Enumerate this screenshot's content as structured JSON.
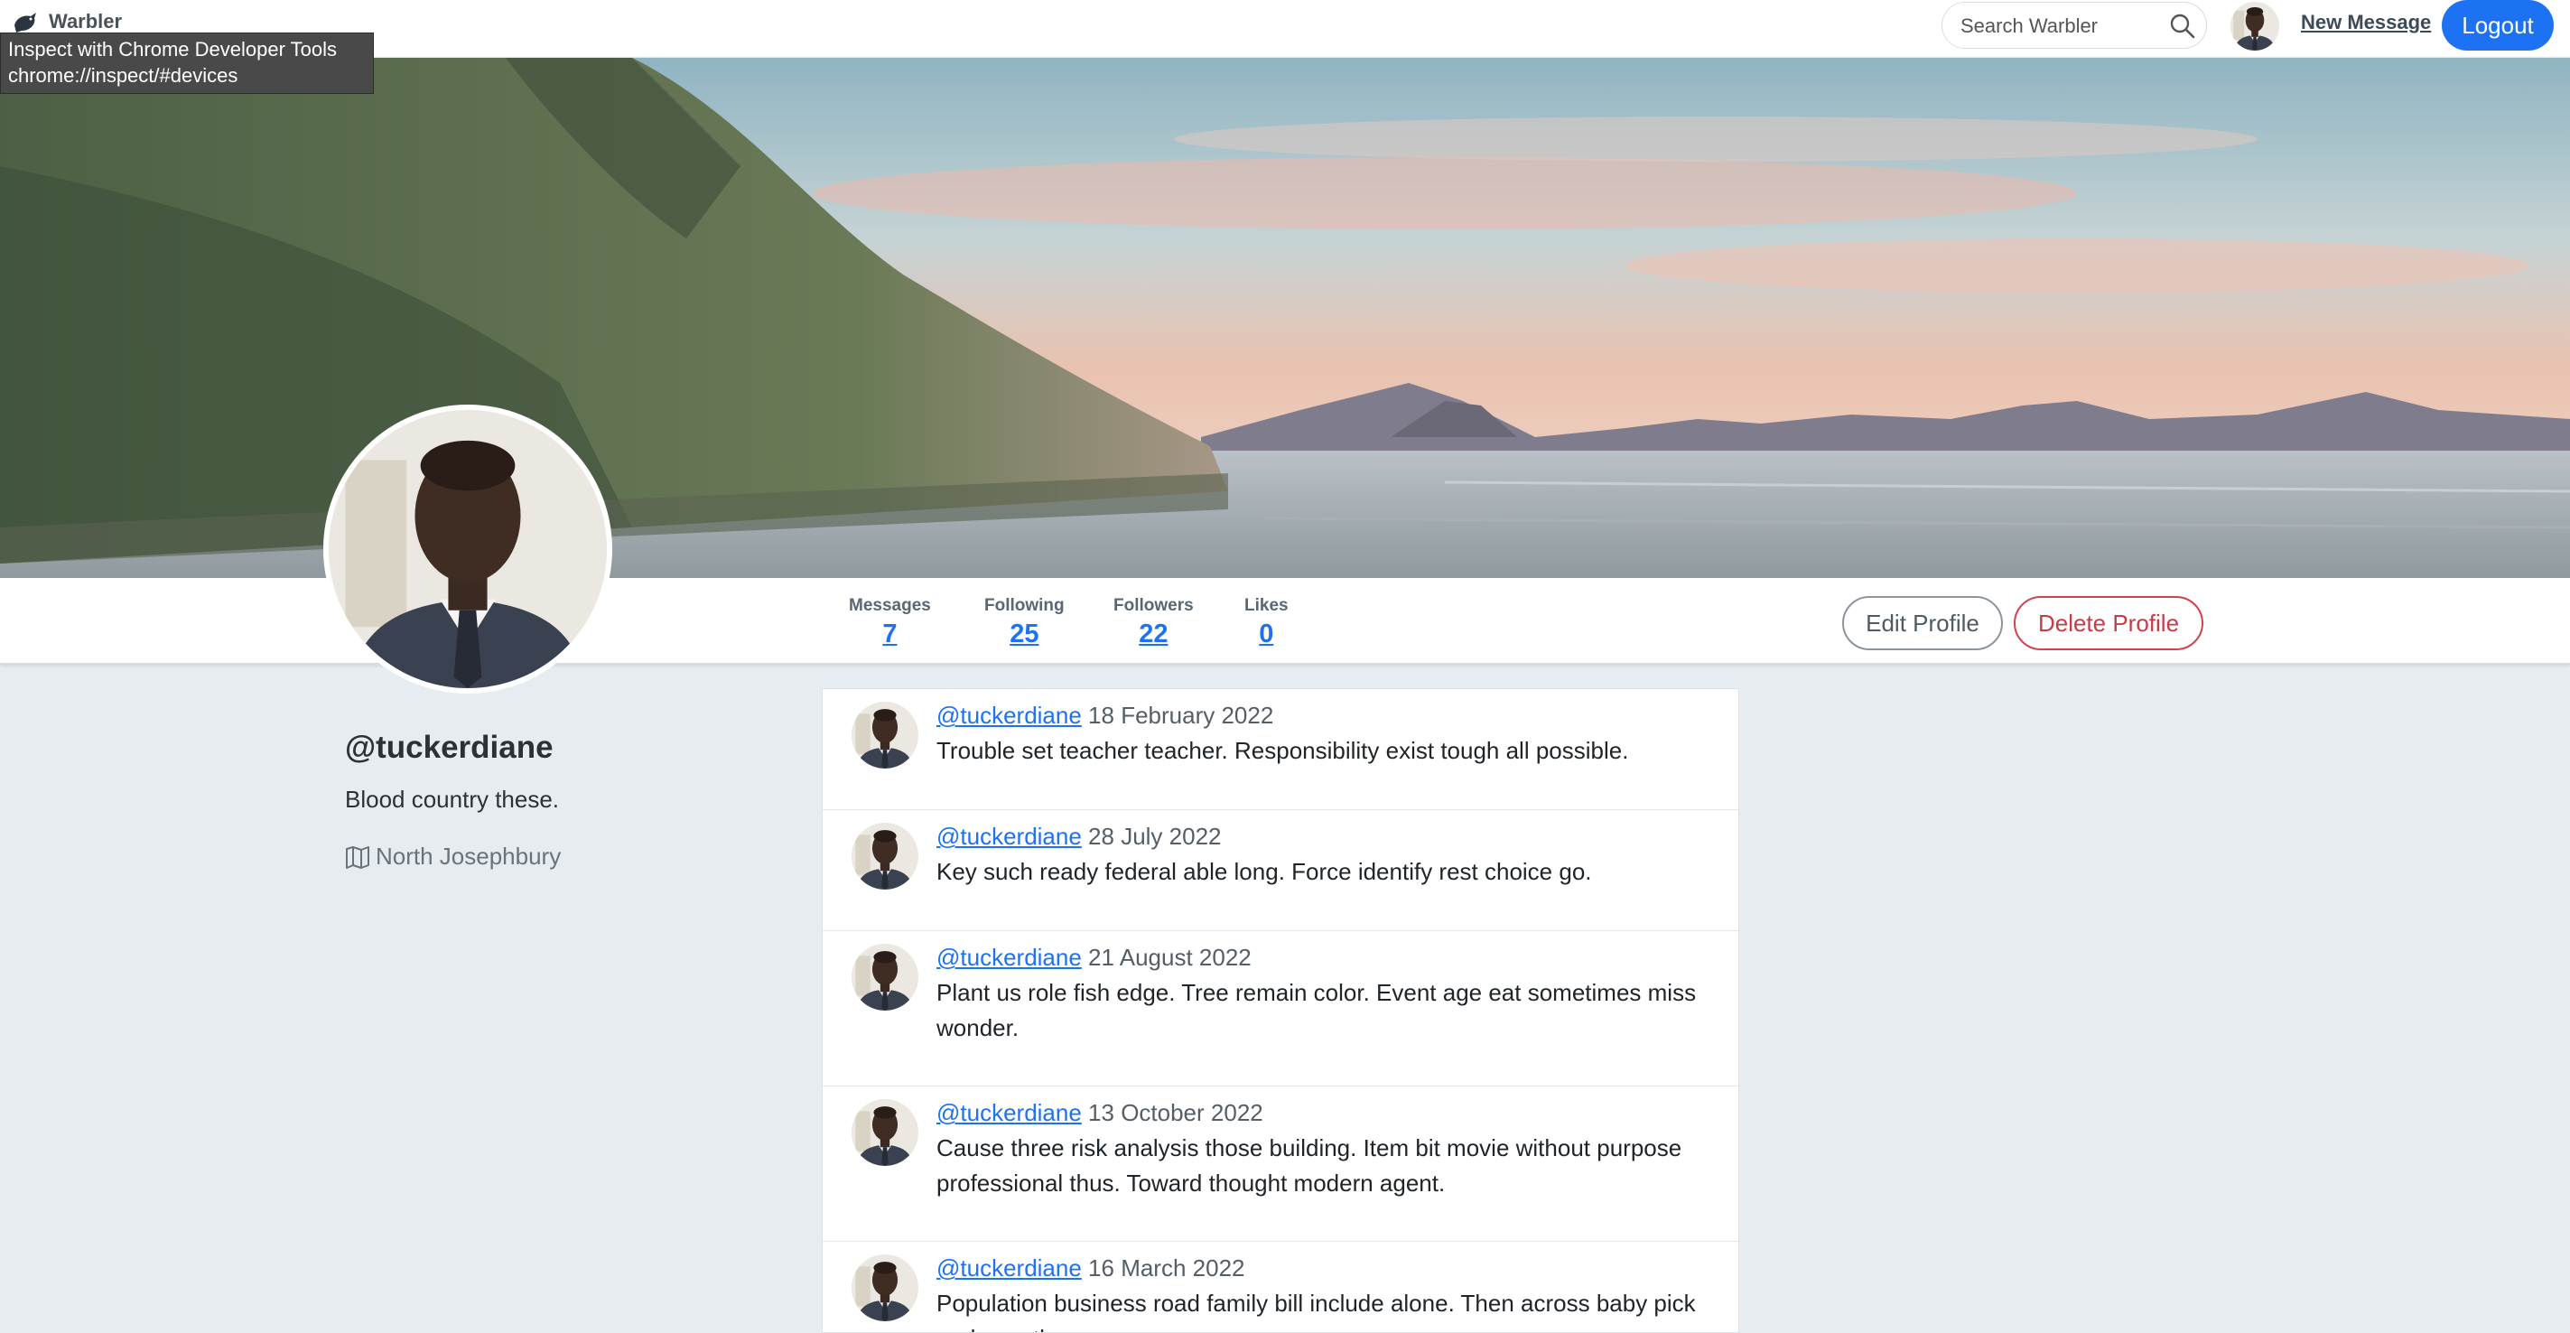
{
  "navbar": {
    "brand": "Warbler",
    "search_placeholder": "Search Warbler",
    "new_message": "New Message",
    "logout": "Logout"
  },
  "devtools_tooltip": {
    "line1": "Inspect with Chrome Developer Tools",
    "line2": "chrome://inspect/#devices"
  },
  "stats": {
    "messages": {
      "label": "Messages",
      "value": "7"
    },
    "following": {
      "label": "Following",
      "value": "25"
    },
    "followers": {
      "label": "Followers",
      "value": "22"
    },
    "likes": {
      "label": "Likes",
      "value": "0"
    }
  },
  "actions": {
    "edit_profile": "Edit Profile",
    "delete_profile": "Delete Profile"
  },
  "profile": {
    "username": "@tuckerdiane",
    "bio": "Blood country these.",
    "location": "North Josephbury"
  },
  "messages": [
    {
      "user": "@tuckerdiane",
      "date": "18 February 2022",
      "text": "Trouble set teacher teacher. Responsibility exist tough all possible."
    },
    {
      "user": "@tuckerdiane",
      "date": "28 July 2022",
      "text": "Key such ready federal able long. Force identify rest choice go."
    },
    {
      "user": "@tuckerdiane",
      "date": "21 August 2022",
      "text": "Plant us role fish edge. Tree remain color. Event age eat sometimes miss wonder."
    },
    {
      "user": "@tuckerdiane",
      "date": "13 October 2022",
      "text": "Cause three risk analysis those building. Item bit movie without purpose professional thus. Toward thought modern agent."
    },
    {
      "user": "@tuckerdiane",
      "date": "16 March 2022",
      "text": "Population business road family bill include alone. Then across baby pick early another."
    }
  ],
  "colors": {
    "accent": "#1d72f3",
    "danger": "#c53c46",
    "page_bg": "#e6ecf0"
  }
}
